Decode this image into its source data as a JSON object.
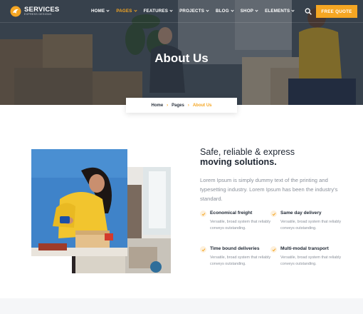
{
  "brand": {
    "name": "SERVICES",
    "tagline": "EXPRESS DESIGNS"
  },
  "nav": {
    "items": [
      {
        "label": "HOME",
        "active": false,
        "has_dropdown": true
      },
      {
        "label": "PAGES",
        "active": true,
        "has_dropdown": true
      },
      {
        "label": "FEATURES",
        "active": false,
        "has_dropdown": true
      },
      {
        "label": "PROJECTS",
        "active": false,
        "has_dropdown": true
      },
      {
        "label": "BLOG",
        "active": false,
        "has_dropdown": true
      },
      {
        "label": "SHOP",
        "active": false,
        "has_dropdown": true
      },
      {
        "label": "ELEMENTS",
        "active": false,
        "has_dropdown": true
      }
    ],
    "search_icon": "search-icon",
    "cta_label": "FREE QUOTE"
  },
  "hero": {
    "title": "About Us"
  },
  "breadcrumb": {
    "home": "Home",
    "pages": "Pages",
    "current": "About Us"
  },
  "about": {
    "heading_line1": "Safe, reliable & express",
    "heading_line2": "moving solutions.",
    "lead": "Lorem Ipsum is simply dummy text of the printing and typesetting industry. Lorem Ipsum has been the industry's standard.",
    "features": [
      {
        "title": "Economical freight",
        "desc": "Versatile, broad system that reliably conveys outstanding."
      },
      {
        "title": "Same day delivery",
        "desc": "Versatile, broad system that reliably conveys outstanding."
      },
      {
        "title": "Time bound deliveries",
        "desc": "Versatile, broad system that reliably conveys outstanding."
      },
      {
        "title": "Multi-modal transport",
        "desc": "Versatile, broad system that reliably conveys outstanding."
      }
    ]
  },
  "colors": {
    "accent": "#f5a623",
    "dark_text": "#1f2733",
    "muted_text": "#8a909a"
  }
}
